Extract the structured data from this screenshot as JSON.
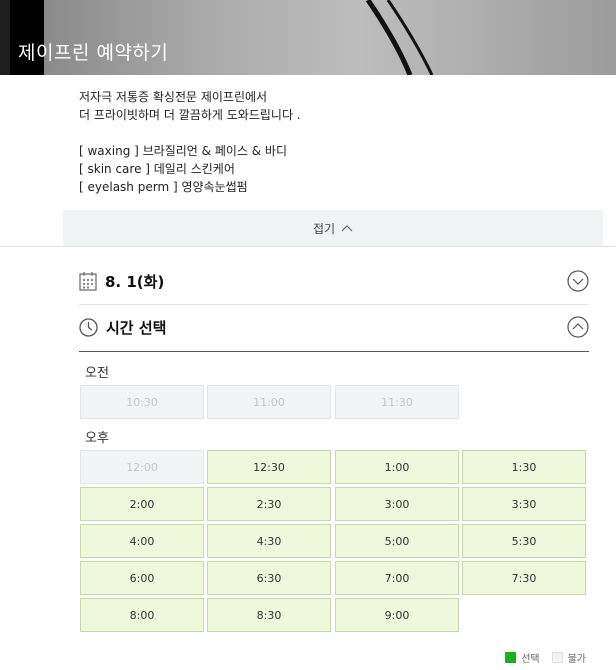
{
  "header": {
    "title": "제이프린 예약하기"
  },
  "description": {
    "lines": [
      "저자극 저통증 확싱전문 제이프린에서",
      "더 프라이빗하며 더 깔끔하게 도와드립니다 .",
      "",
      "[ waxing ] 브라질리언 & 페이스 & 바디",
      "[ skin care ] 데일리 스킨케어",
      "[ eyelash perm ] 영양속눈썹펌"
    ]
  },
  "fold": {
    "label": "접기"
  },
  "date_section": {
    "value": "8. 1(화)",
    "icon": "calendar-icon",
    "toggle_icon": "chevron-down-circle-icon"
  },
  "time_section": {
    "label": "시간 선택",
    "icon": "clock-icon",
    "toggle_icon": "chevron-up-circle-icon"
  },
  "am": {
    "label": "오전",
    "slots": [
      {
        "time": "10:30",
        "available": false
      },
      {
        "time": "11:00",
        "available": false
      },
      {
        "time": "11:30",
        "available": false
      }
    ]
  },
  "pm": {
    "label": "오후",
    "slots": [
      {
        "time": "12:00",
        "available": false
      },
      {
        "time": "12:30",
        "available": true
      },
      {
        "time": "1:00",
        "available": true
      },
      {
        "time": "1:30",
        "available": true
      },
      {
        "time": "2:00",
        "available": true
      },
      {
        "time": "2:30",
        "available": true
      },
      {
        "time": "3:00",
        "available": true
      },
      {
        "time": "3:30",
        "available": true
      },
      {
        "time": "4:00",
        "available": true
      },
      {
        "time": "4:30",
        "available": true
      },
      {
        "time": "5:00",
        "available": true
      },
      {
        "time": "5:30",
        "available": true
      },
      {
        "time": "6:00",
        "available": true
      },
      {
        "time": "6:30",
        "available": true
      },
      {
        "time": "7:00",
        "available": true
      },
      {
        "time": "7:30",
        "available": true
      },
      {
        "time": "8:00",
        "available": true
      },
      {
        "time": "8:30",
        "available": true
      },
      {
        "time": "9:00",
        "available": true
      }
    ]
  },
  "legend": {
    "selected": "선택",
    "unavailable": "불가"
  },
  "colors": {
    "selected": "#16b21a",
    "available_bg": "#f0f8dc",
    "unavailable_bg": "#f2f5f6"
  }
}
